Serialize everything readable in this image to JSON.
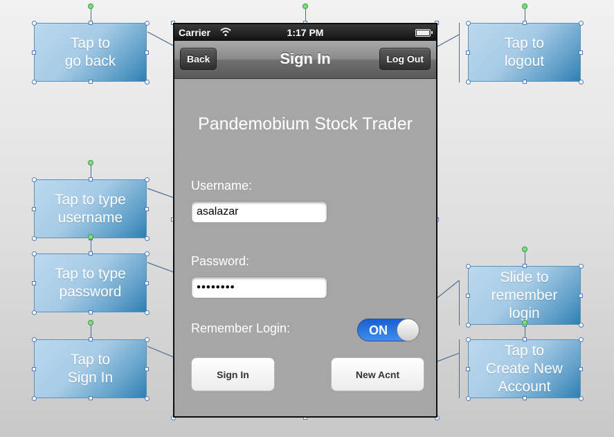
{
  "status_bar": {
    "carrier": "Carrier",
    "time": "1:17 PM"
  },
  "nav": {
    "back": "Back",
    "title": "Sign In",
    "logout": "Log Out"
  },
  "app_title": "Pandemobium Stock Trader",
  "username": {
    "label": "Username:",
    "value": "asalazar"
  },
  "password": {
    "label": "Password:",
    "value": "••••••••"
  },
  "remember": {
    "label": "Remember Login:",
    "state": "ON"
  },
  "buttons": {
    "sign_in": "Sign In",
    "new_account": "New Acnt"
  },
  "callouts": {
    "back": "Tap to\ngo back",
    "logout": "Tap to\nlogout",
    "username": "Tap to type\nusername",
    "password": "Tap to type\npassword",
    "remember": "Slide to\nremember\nlogin",
    "sign_in": "Tap to\nSign In",
    "create": "Tap to\nCreate New\nAccount"
  },
  "colors": {
    "callout_blue": "#2e7fb3",
    "toggle_blue": "#1a5fd0",
    "connector": "#4a6c92"
  }
}
